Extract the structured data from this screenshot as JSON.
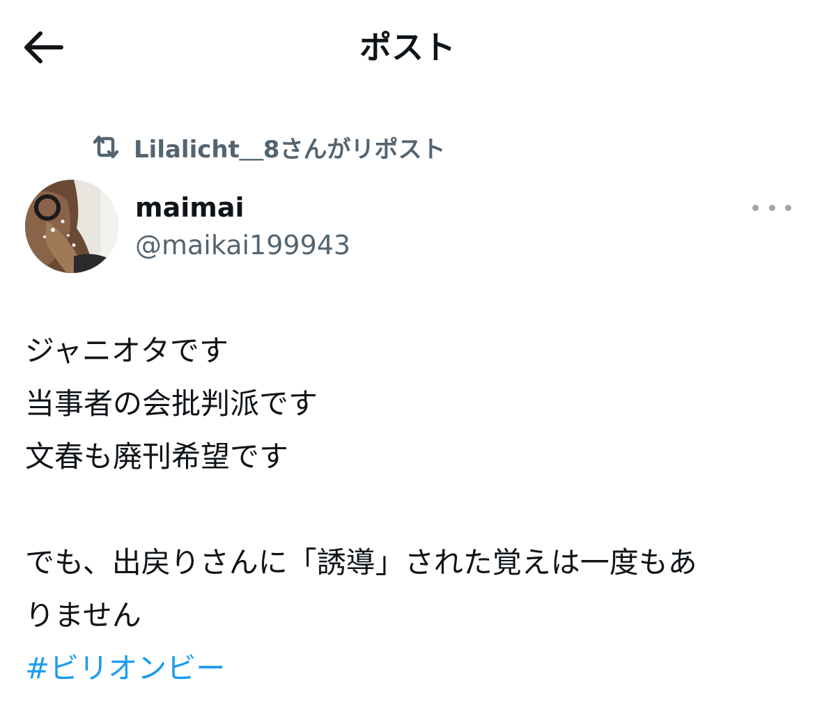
{
  "header": {
    "title": "ポスト",
    "back_icon": "arrow-left-icon"
  },
  "repost": {
    "icon": "repost-icon",
    "text": "Lilalicht＿8さんがリポスト"
  },
  "author": {
    "display_name": "maimai",
    "handle": "@maikai199943",
    "avatar_icon": "avatar"
  },
  "more_icon": "more-horizontal-icon",
  "post": {
    "lines": [
      "ジャニオタです",
      "当事者の会批判派です",
      "文春も廃刊希望です",
      "",
      "でも、出戻りさんに「誘導」された覚えは一度もあ",
      "りません"
    ],
    "hashtag": "#ビリオンビー"
  },
  "colors": {
    "text": "#0f1419",
    "secondary": "#536471",
    "link": "#1d9bf0"
  }
}
